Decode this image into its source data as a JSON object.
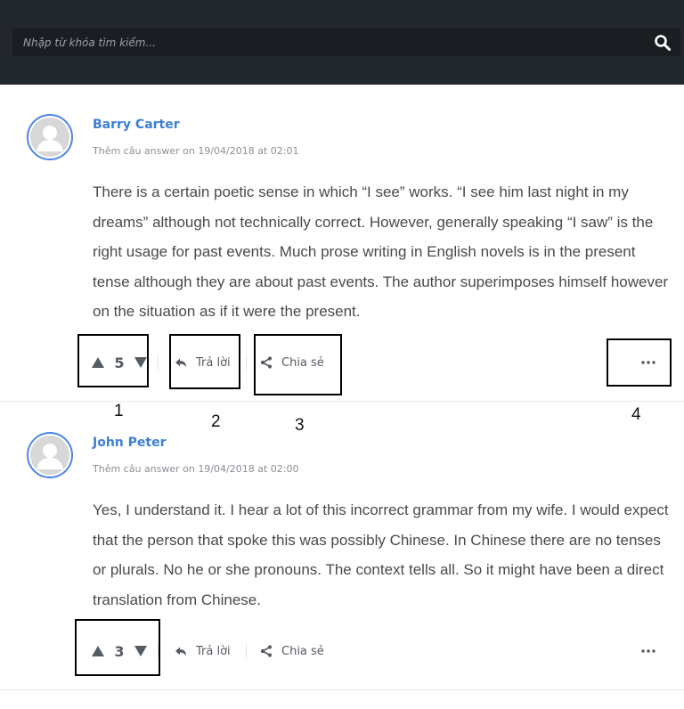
{
  "search": {
    "placeholder": "Nhập từ khóa tìm kiếm..."
  },
  "answers": [
    {
      "author": "Barry Carter",
      "meta": "Thêm câu answer on 19/04/2018 at 02:01",
      "body": "There is a certain poetic sense in which “I see” works. “I see him last night in my dreams” although not technically correct. However, generally speaking “I saw” is the right usage for past events. Much prose writing in English novels is in the present tense although they are about past events. The author superimposes himself however on the situation as if it were the present.",
      "votes": "5",
      "reply_label": "Trả lời",
      "share_label": "Chia sẻ"
    },
    {
      "author": "John Peter",
      "meta": "Thêm câu answer on 19/04/2018 at 02:00",
      "body": "Yes, I understand it. I hear a lot of this incorrect grammar from my wife. I would expect that the person that spoke this was possibly Chinese. In Chinese there are no tenses or plurals. No he or she pronouns. The context tells all. So it might have been a direct translation from Chinese.",
      "votes": "3",
      "reply_label": "Trả lời",
      "share_label": "Chia sẻ"
    }
  ],
  "annotations": {
    "m1": "1",
    "m2": "2",
    "m3": "3",
    "m4": "4"
  },
  "colors": {
    "header_bg": "#22262d",
    "author_link": "#3d7fd4",
    "avatar_ring": "#4a86e8"
  },
  "icons": [
    "search-icon",
    "avatar-icon",
    "upvote-icon",
    "downvote-icon",
    "reply-icon",
    "share-icon",
    "more-icon"
  ]
}
